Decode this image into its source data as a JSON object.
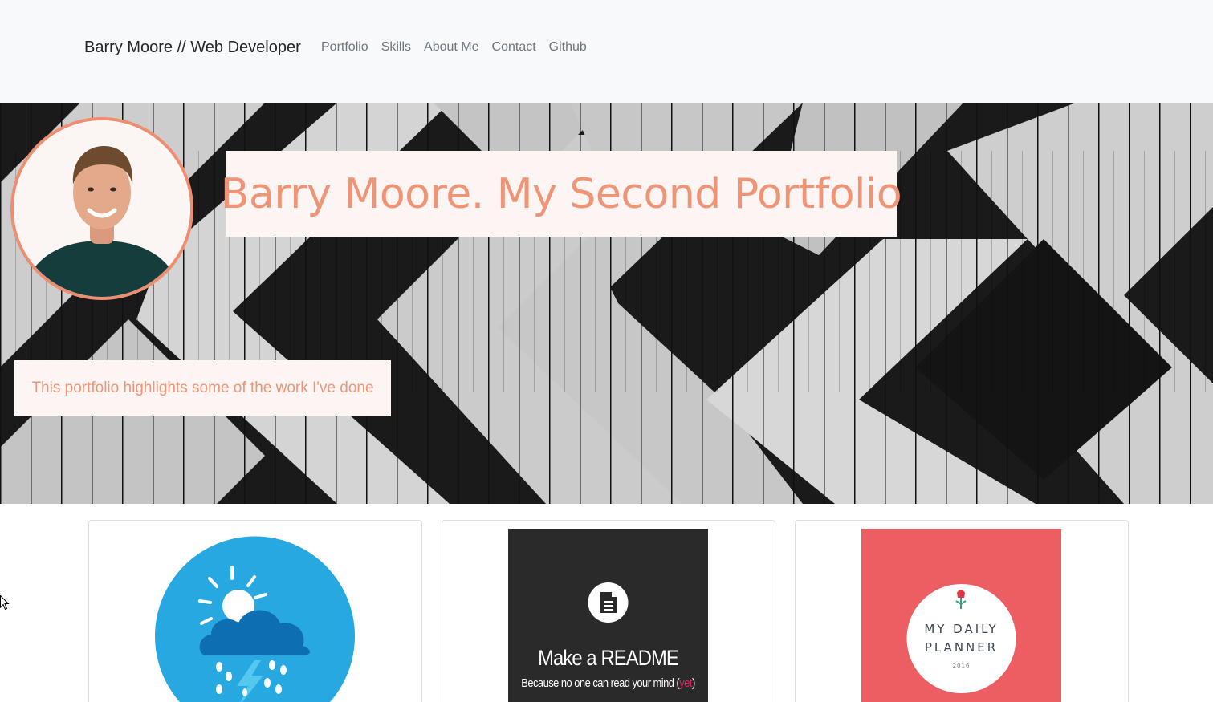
{
  "navbar": {
    "brand": "Barry Moore // Web Developer",
    "links": [
      "Portfolio",
      "Skills",
      "About Me",
      "Contact",
      "Github"
    ]
  },
  "hero": {
    "title": "Barry Moore. My Second Portfolio",
    "subtitle": "This portfolio highlights some of the work I've done"
  },
  "cards": [
    {
      "image": "weather-icon"
    },
    {
      "image": "readme-icon",
      "heading": "Make a README",
      "tagline_pre": "Because no one can read your mind (",
      "tagline_accent": "yet",
      "tagline_post": ")"
    },
    {
      "image": "planner-icon",
      "line1": "MY DAILY",
      "line2": "PLANNER",
      "year": "2016"
    }
  ],
  "colors": {
    "accent": "#ee8e70",
    "navbar_bg": "#f8f9fa",
    "weather_blue": "#28a8e0",
    "readme_bg": "#2b2a2b",
    "planner_red": "#ed5e63"
  }
}
